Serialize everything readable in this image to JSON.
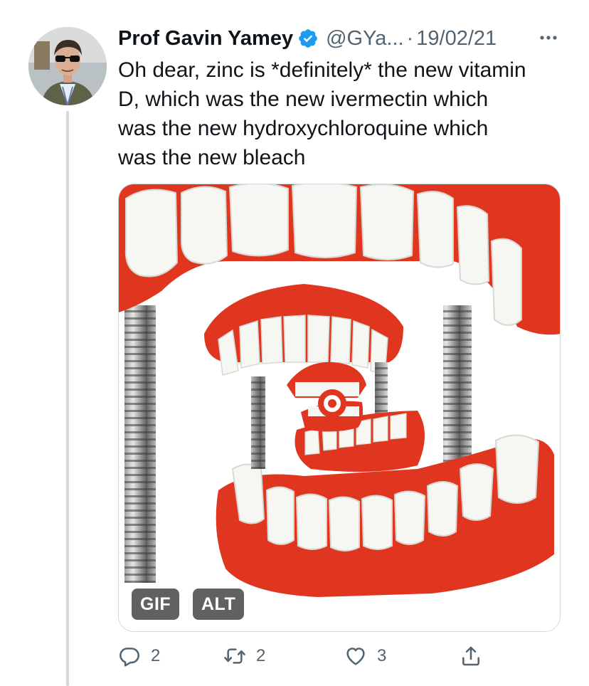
{
  "tweet": {
    "name": "Prof Gavin Yamey",
    "handle": "@GYa...",
    "separator": "·",
    "date": "19/02/21",
    "text_lines": [
      "Oh dear, zinc is *definitely* the new vitamin",
      "D, which was the new ivermectin which",
      "was the new hydroxychloroquine which",
      "was the new bleach"
    ],
    "media": {
      "gif_badge": "GIF",
      "alt_badge": "ALT"
    },
    "actions": {
      "replies": "2",
      "retweets": "2",
      "likes": "3"
    }
  },
  "icons": {
    "verified": "verified-badge-icon",
    "more": "more-icon",
    "reply": "reply-icon",
    "retweet": "retweet-icon",
    "like": "like-icon",
    "share": "share-icon"
  },
  "colors": {
    "verified_blue": "#1d9bf0",
    "text": "#0f1419",
    "secondary": "#536471",
    "border": "#cfd9de",
    "gum_red": "#e0361f"
  }
}
